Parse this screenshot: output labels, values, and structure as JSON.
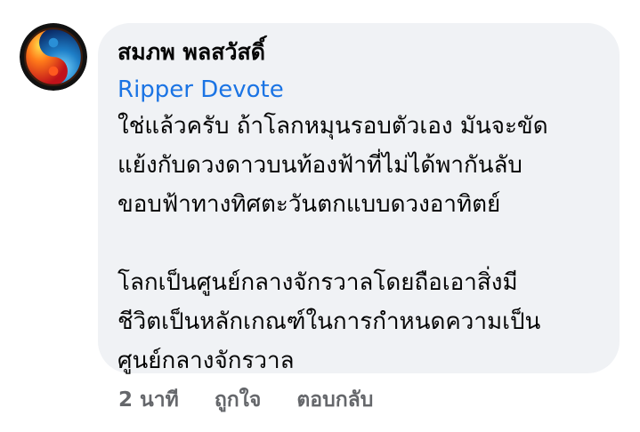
{
  "comment": {
    "author_name": "สมภพ พลสวัสดิ์",
    "mention": "Ripper Devote",
    "paragraphs": [
      "ใช่แล้วครับ ถ้าโลกหมุนรอบตัวเอง มันจะขัด\nแย้งกับดวงดาวบนท้องฟ้าที่ไม่ได้พากันลับ\nขอบฟ้าทางทิศตะวันตกแบบดวงอาทิตย์",
      "โลกเป็นศูนย์กลางจักรวาลโดยถือเอาสิ่งมี\nชีวิตเป็นหลักเกณฑ์ในการกำหนดความเป็น\nศูนย์กลางจักรวาล"
    ]
  },
  "actions": {
    "time": "2 นาที",
    "like": "ถูกใจ",
    "reply": "ตอบกลับ"
  },
  "colors": {
    "bubble_bg": "#f0f2f5",
    "mention": "#1b74e4",
    "action_text": "#65676b"
  }
}
